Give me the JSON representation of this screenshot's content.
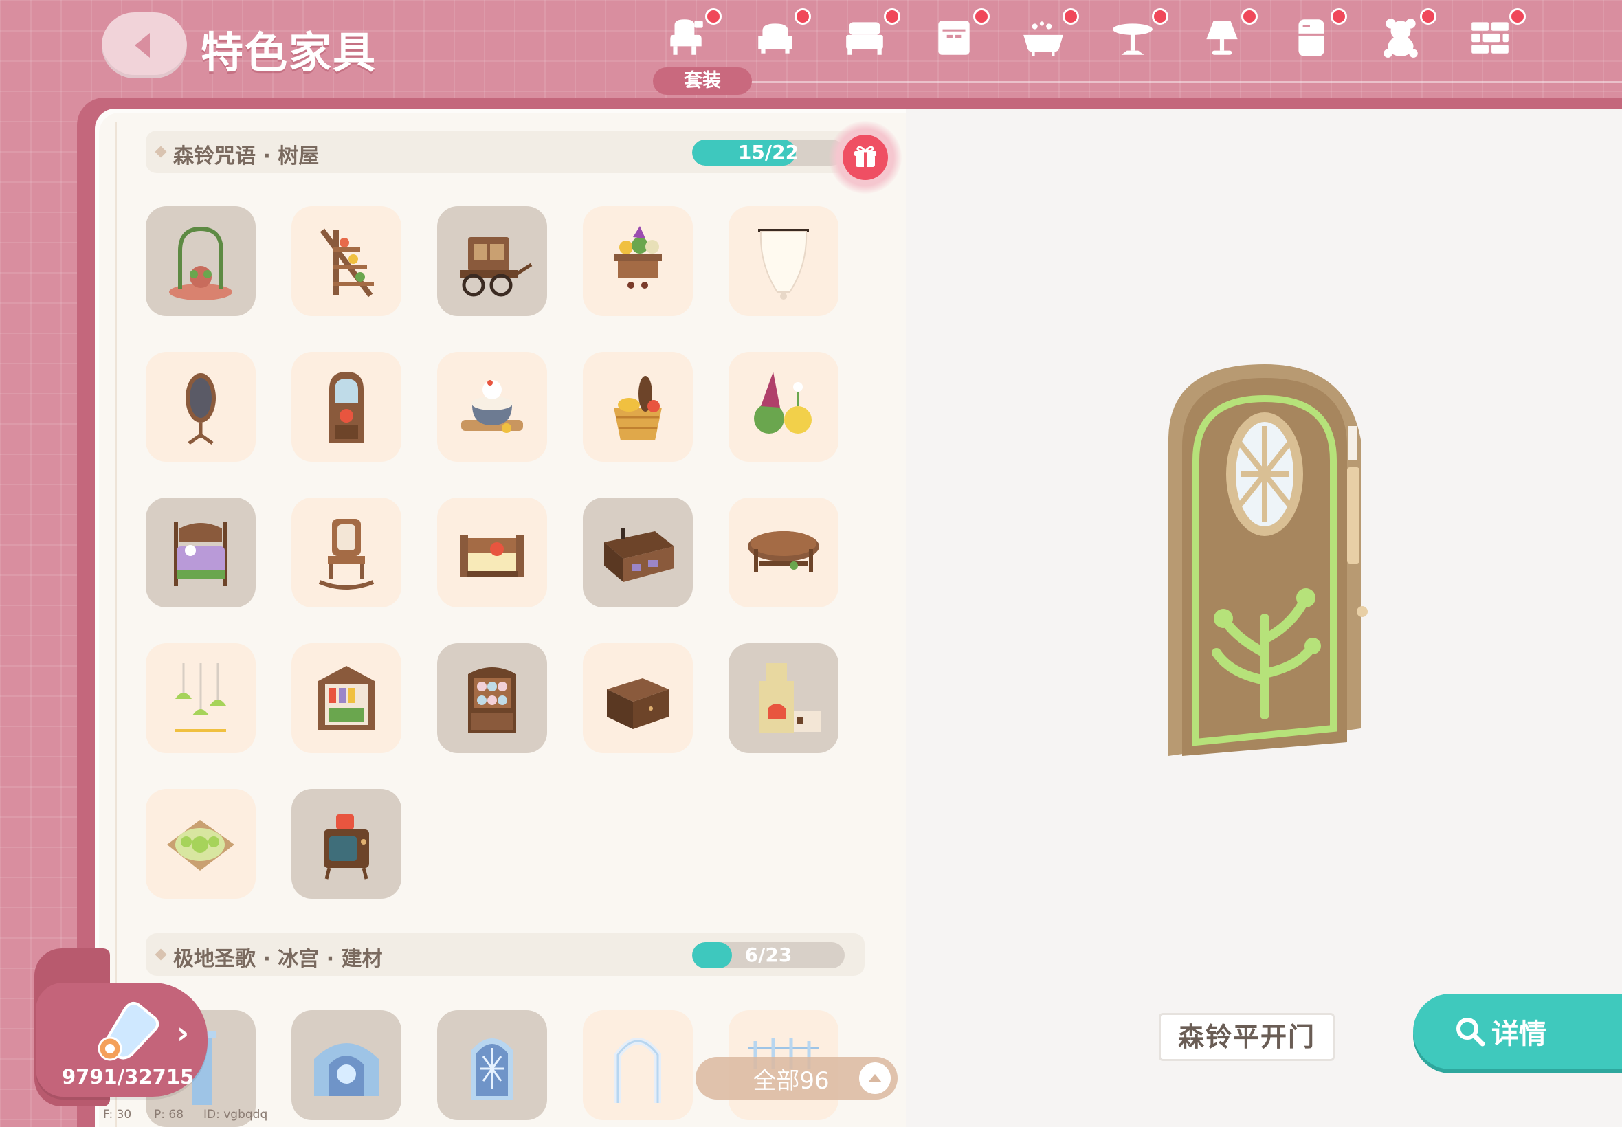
{
  "header": {
    "title": "特色家具",
    "active_tab_label": "套装",
    "tabs": [
      {
        "icon": "suit-icon"
      },
      {
        "icon": "armchair-icon"
      },
      {
        "icon": "bed-icon"
      },
      {
        "icon": "cabinet-icon"
      },
      {
        "icon": "bathtub-icon"
      },
      {
        "icon": "table-icon"
      },
      {
        "icon": "lamp-icon"
      },
      {
        "icon": "fridge-icon"
      },
      {
        "icon": "teddy-bear-icon"
      },
      {
        "icon": "wall-brick-icon"
      }
    ]
  },
  "sections": [
    {
      "name": "森铃咒语 · 树屋",
      "progress_text": "15/22",
      "progress_value": 0.68
    },
    {
      "name": "极地圣歌 · 冰宫 · 建材",
      "progress_text": "6/23",
      "progress_value": 0.26
    }
  ],
  "collection": {
    "count": "9791/32715"
  },
  "debug": {
    "f": "F: 30",
    "p": "P: 68",
    "id": "ID: vgbqdq"
  },
  "bottom_pill": {
    "label": "全部96"
  },
  "preview": {
    "item_name": "森铃平开门",
    "detail_label": "详情"
  },
  "colors": {
    "accent_teal": "#3fc9bd",
    "brand_pink": "#d98e9f",
    "badge_red": "#f0485a"
  }
}
